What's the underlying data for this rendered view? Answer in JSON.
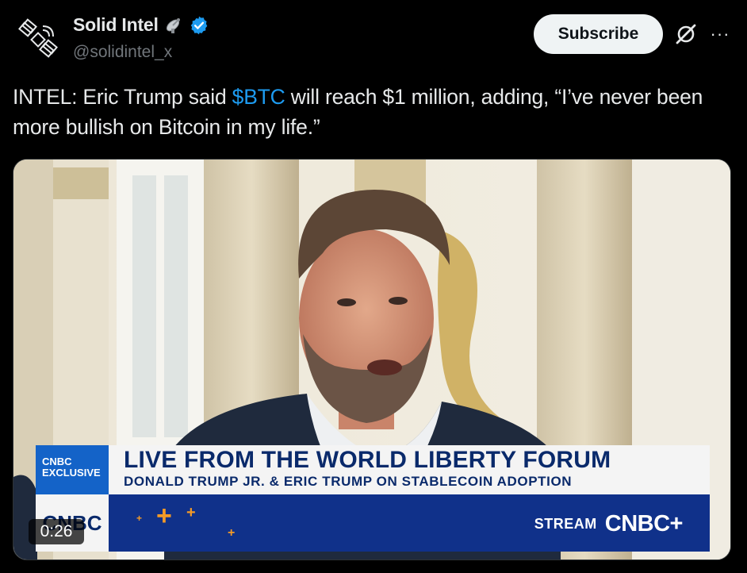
{
  "author": {
    "display_name": "Solid Intel",
    "handle": "@solidintel_x",
    "avatar_icon": "satellite-icon",
    "name_emoji_icon": "satellite-dish-icon",
    "verified_icon": "verified-badge-icon"
  },
  "actions": {
    "subscribe_label": "Subscribe",
    "grok_icon": "grok-icon",
    "more_icon": "more-options-icon",
    "more_glyph": "···"
  },
  "tweet": {
    "text_before": "INTEL: Eric Trump said ",
    "cashtag": "$BTC",
    "text_after": " will reach $1 million, adding, “I’ve never been more bullish on Bitcoin in my life.”"
  },
  "video": {
    "duration": "0:26",
    "lower_third": {
      "tag": "CNBC EXCLUSIVE",
      "title": "LIVE FROM THE WORLD LIBERTY FORUM",
      "subtitle": "DONALD TRUMP JR. & ERIC TRUMP ON STABLECOIN ADOPTION",
      "logo_text": "CNBC",
      "stream_label": "STREAM",
      "stream_brand": "CNBC+"
    }
  },
  "colors": {
    "link": "#1d9bf0",
    "verified": "#1d9bf0",
    "lower_third_blue": "#10318a",
    "accent_orange": "#f39a27"
  }
}
